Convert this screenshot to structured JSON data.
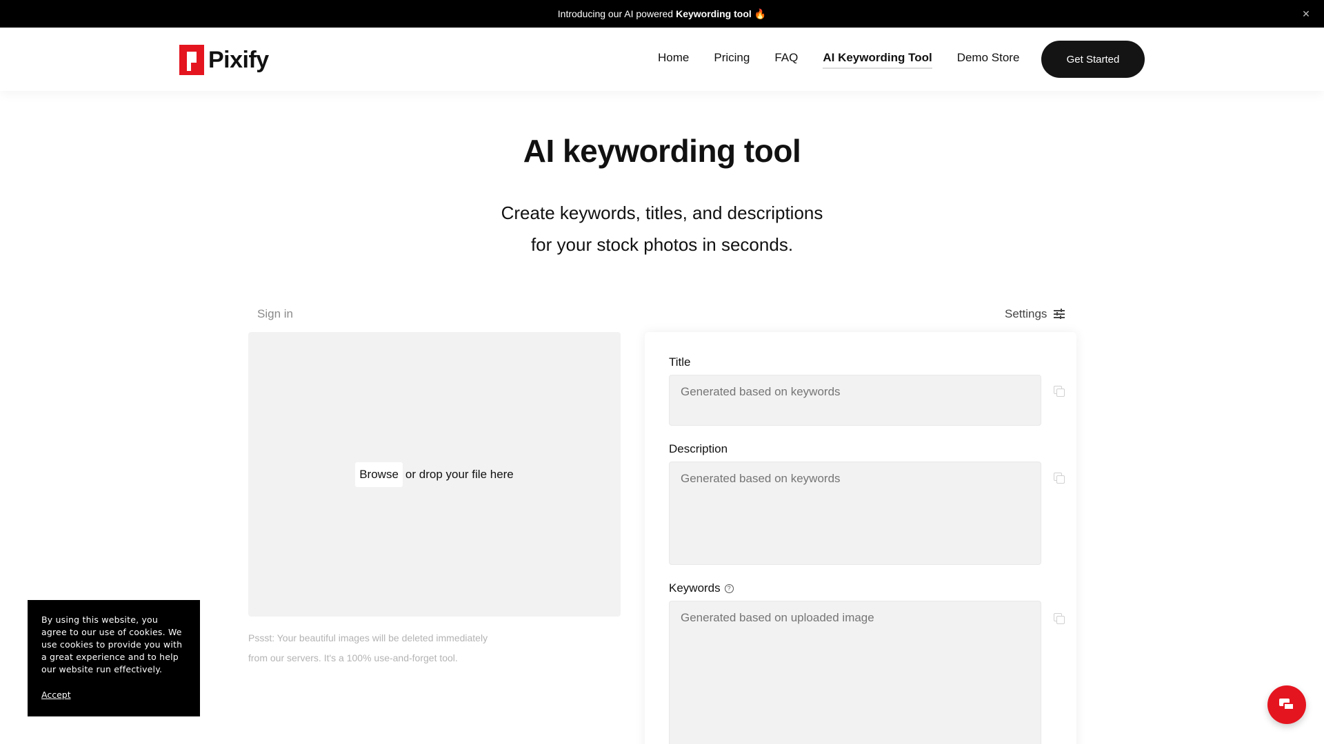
{
  "announcement": {
    "prefix": "Introducing our AI powered",
    "highlight": "Keywording tool",
    "emoji": "🔥",
    "close_icon": "close-icon"
  },
  "header": {
    "logo_text": "Pixify",
    "nav": [
      {
        "label": "Home"
      },
      {
        "label": "Pricing"
      },
      {
        "label": "FAQ"
      },
      {
        "label": "AI Keywording Tool",
        "active": true
      },
      {
        "label": "Demo Store"
      }
    ],
    "cta_label": "Get Started"
  },
  "hero": {
    "title": "AI keywording tool",
    "subtitle_line1": "Create keywords, titles, and descriptions",
    "subtitle_line2": "for your stock photos in seconds."
  },
  "tool": {
    "signin_label": "Sign in",
    "settings_label": "Settings",
    "settings_icon": "sliders-icon",
    "dropzone": {
      "browse_label": "Browse",
      "drop_text": "or drop your file here"
    },
    "note_line1": "Pssst: Your beautiful images will be deleted immediately",
    "note_line2": "from our servers. It's a 100% use-and-forget tool.",
    "fields": {
      "title": {
        "label": "Title",
        "placeholder": "Generated based on keywords"
      },
      "description": {
        "label": "Description",
        "placeholder": "Generated based on keywords"
      },
      "keywords": {
        "label": "Keywords",
        "placeholder": "Generated based on uploaded image"
      }
    }
  },
  "cookie": {
    "text": "By using this website, you agree to our use of cookies. We use cookies to provide you with a great experience and to help our website run effectively.",
    "accept_label": "Accept"
  },
  "chat": {
    "icon": "chat-icon"
  },
  "colors": {
    "brand_red": "#e4151f",
    "dark": "#141414",
    "field_bg": "#f2f2f2"
  }
}
